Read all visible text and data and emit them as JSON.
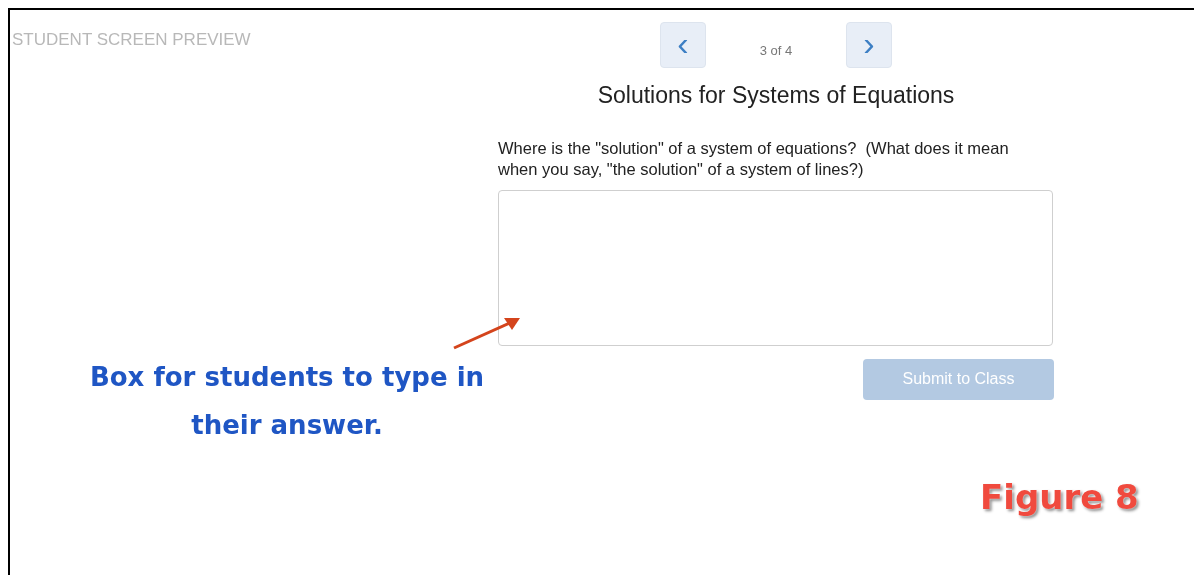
{
  "header": {
    "label": "STUDENT SCREEN PREVIEW"
  },
  "pager": {
    "previous": "‹",
    "next": "›",
    "position": "3 of 4"
  },
  "title": "Solutions for Systems of Equations",
  "question": "Where is the \"solution\" of a system of equations?  (What does it mean when you say, \"the solution\" of a system of lines?)",
  "submit": {
    "label": "Submit to Class",
    "disabled": true
  },
  "annotation": "Box for students to type in their answer.",
  "figure_label": "Figure 8"
}
